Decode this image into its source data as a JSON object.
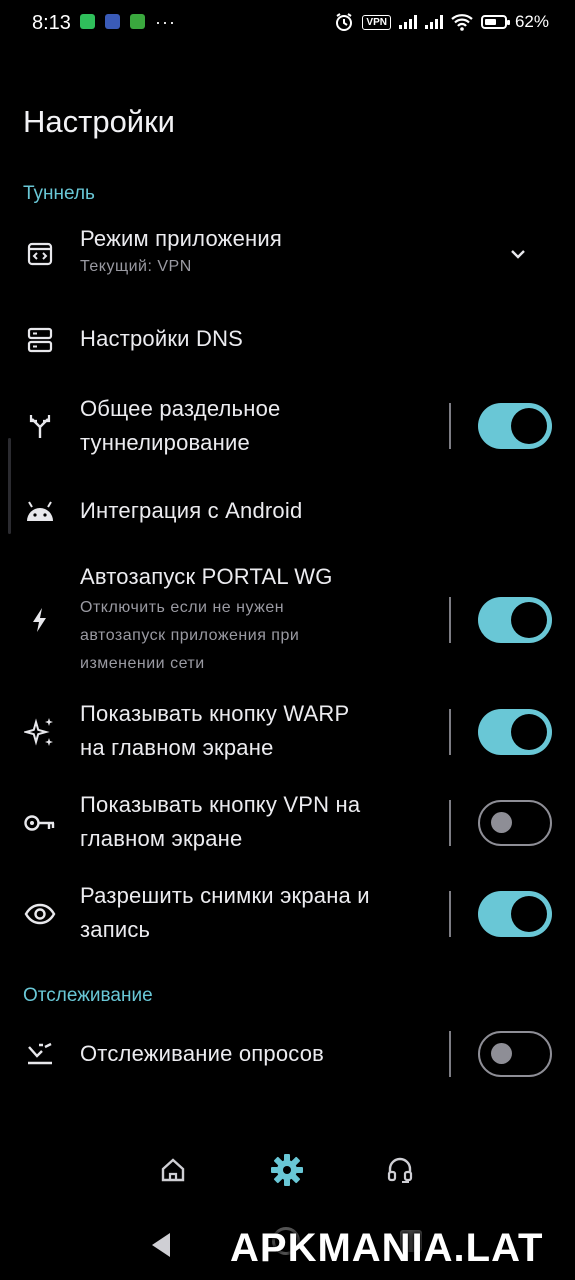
{
  "status_bar": {
    "time": "8:13",
    "vpn_label": "VPN",
    "battery_percent": 62,
    "battery_text": "62%"
  },
  "header": {
    "title": "Настройки"
  },
  "sections": {
    "tunnel": "Туннель",
    "tracking": "Отслеживание"
  },
  "settings": {
    "app_mode": {
      "title": "Режим приложения",
      "subtitle": "Текущий: VPN",
      "icon": "app-window-icon"
    },
    "dns": {
      "title": "Настройки DNS",
      "icon": "dns-server-icon"
    },
    "split_tunnel": {
      "title_line1": "Общее раздельное",
      "title_line2": "туннелирование",
      "enabled": true,
      "icon": "split-arrows-icon"
    },
    "android": {
      "title": "Интеграция с Android",
      "icon": "android-icon"
    },
    "autostart": {
      "title": "Автозапуск PORTAL WG",
      "sub_line1": "Отключить если не нужен",
      "sub_line2": "автозапуск приложения при",
      "sub_line3": "изменении сети",
      "enabled": true,
      "icon": "bolt-icon"
    },
    "warp_button": {
      "title_line1": "Показывать кнопку WARP",
      "title_line2": "на главном экране",
      "enabled": true,
      "icon": "sparkles-icon"
    },
    "vpn_button": {
      "title_line1": "Показывать кнопку VPN на",
      "title_line2": "главном экране",
      "enabled": false,
      "icon": "key-icon"
    },
    "screenshots": {
      "title_line1": "Разрешить снимки экрана и",
      "title_line2": "запись",
      "enabled": true,
      "icon": "eye-icon"
    },
    "poll_tracking": {
      "title": "Отслеживание опросов",
      "enabled": false,
      "icon": "poll-tracking-icon"
    }
  },
  "bottom_nav": {
    "items": [
      "home-icon",
      "settings-gear-icon",
      "headset-icon"
    ],
    "active": "settings-gear-icon"
  },
  "watermark": "APKMANIA.LAT",
  "colors": {
    "accent": "#69c7d6",
    "background": "#000000",
    "toggle_off": "#8e8e96"
  }
}
